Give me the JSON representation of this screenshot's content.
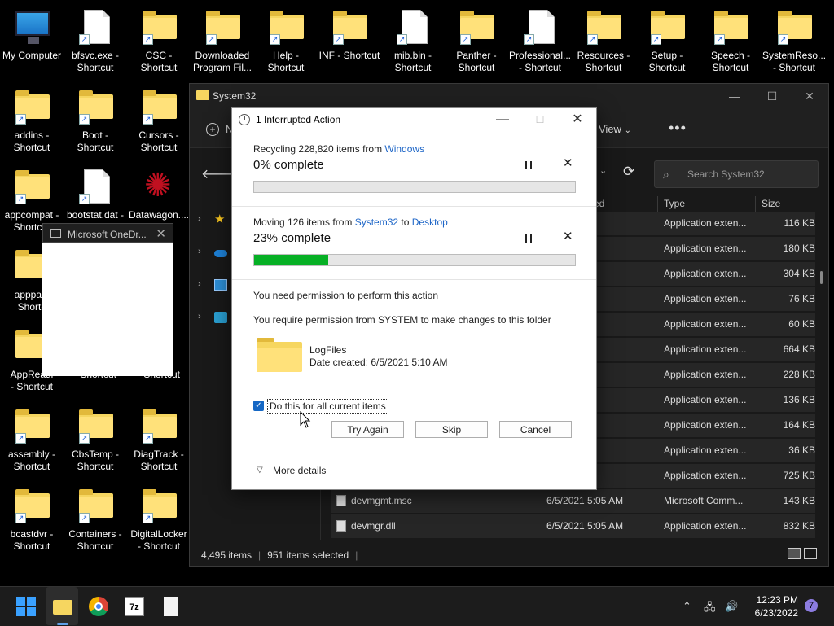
{
  "desktop": {
    "icons": [
      {
        "label1": "My Computer",
        "label2": ""
      },
      {
        "label1": "bfsvc.exe -",
        "label2": "Shortcut"
      },
      {
        "label1": "CSC -",
        "label2": "Shortcut"
      },
      {
        "label1": "Downloaded",
        "label2": "Program Fil..."
      },
      {
        "label1": "Help -",
        "label2": "Shortcut"
      },
      {
        "label1": "INF - Shortcut",
        "label2": ""
      },
      {
        "label1": "mib.bin -",
        "label2": "Shortcut"
      },
      {
        "label1": "Panther -",
        "label2": "Shortcut"
      },
      {
        "label1": "Professional...",
        "label2": "- Shortcut"
      },
      {
        "label1": "Resources -",
        "label2": "Shortcut"
      },
      {
        "label1": "Setup -",
        "label2": "Shortcut"
      },
      {
        "label1": "Speech -",
        "label2": "Shortcut"
      },
      {
        "label1": "SystemReso...",
        "label2": "- Shortcut"
      },
      {
        "label1": "addins -",
        "label2": "Shortcut"
      },
      {
        "label1": "Boot -",
        "label2": "Shortcut"
      },
      {
        "label1": "Cursors -",
        "label2": "Shortcut"
      },
      {
        "label1": "appcompat -",
        "label2": "Shortcut"
      },
      {
        "label1": "bootstat.dat -",
        "label2": ""
      },
      {
        "label1": "Datawagon....",
        "label2": ""
      },
      {
        "label1": "apppatc",
        "label2": "Shortc"
      },
      {
        "label1": "AppReadi",
        "label2": "- Shortcut"
      },
      {
        "label1": "",
        "label2": "- Shortcut"
      },
      {
        "label1": "",
        "label2": "- Shortcut"
      },
      {
        "label1": "assembly -",
        "label2": "Shortcut"
      },
      {
        "label1": "CbsTemp -",
        "label2": "Shortcut"
      },
      {
        "label1": "DiagTrack -",
        "label2": "Shortcut"
      },
      {
        "label1": "bcastdvr -",
        "label2": "Shortcut"
      },
      {
        "label1": "Containers -",
        "label2": "Shortcut"
      },
      {
        "label1": "DigitalLocker",
        "label2": "- Shortcut"
      }
    ]
  },
  "explorer": {
    "title": "System32",
    "new_label": "N",
    "view_label": "View",
    "view_chevron": "⌄",
    "more_label": "•••",
    "search_placeholder": "Search System32",
    "columns": {
      "date": "ed",
      "type": "Type",
      "size": "Size"
    },
    "rows": [
      {
        "name": "",
        "date": "",
        "type": "Application exten...",
        "size": "116 KB"
      },
      {
        "name": "",
        "date": ":22 PM",
        "type": "Application exten...",
        "size": "180 KB"
      },
      {
        "name": "",
        "date": ":05 AM",
        "type": "Application exten...",
        "size": "304 KB"
      },
      {
        "name": "",
        "date": ":23 PM",
        "type": "Application exten...",
        "size": "76 KB"
      },
      {
        "name": "",
        "date": ":23 PM",
        "type": "Application exten...",
        "size": "60 KB"
      },
      {
        "name": "",
        "date": ":23 PM",
        "type": "Application exten...",
        "size": "664 KB"
      },
      {
        "name": "",
        "date": ":23 PM",
        "type": "Application exten...",
        "size": "228 KB"
      },
      {
        "name": "",
        "date": ":23 PM",
        "type": "Application exten...",
        "size": "136 KB"
      },
      {
        "name": "",
        "date": ":24 PM",
        "type": "Application exten...",
        "size": "164 KB"
      },
      {
        "name": "",
        "date": ":06 AM",
        "type": "Application exten...",
        "size": "36 KB"
      },
      {
        "name": "",
        "date": ":05 AM",
        "type": "Application exten...",
        "size": "725 KB"
      },
      {
        "name": "devmgmt.msc",
        "date": "6/5/2021 5:05 AM",
        "type": "Microsoft Comm...",
        "size": "143 KB"
      },
      {
        "name": "devmgr.dll",
        "date": "6/5/2021 5:05 AM",
        "type": "Application exten...",
        "size": "832 KB"
      }
    ],
    "status": {
      "items": "4,495 items",
      "selected": "951 items selected"
    }
  },
  "onedrive": {
    "title": "Microsoft OneDr..."
  },
  "dialog": {
    "title": "1 Interrupted Action",
    "op1": {
      "verb": "Recycling 228,820 items from ",
      "source": "Windows",
      "percent_text": "0% complete",
      "progress": 0
    },
    "op2": {
      "verb": "Moving 126 items from ",
      "source": "System32",
      "to": " to ",
      "dest": "Desktop",
      "percent_text": "23% complete",
      "progress": 23
    },
    "permission_title": "You need permission to perform this action",
    "permission_detail": "You require permission from SYSTEM to make changes to this folder",
    "folder_name": "LogFiles",
    "folder_date": "Date created: 6/5/2021 5:10 AM",
    "checkbox_label": "Do this for all current items",
    "checkbox_checked": true,
    "buttons": {
      "try_again": "Try Again",
      "skip": "Skip",
      "cancel": "Cancel"
    },
    "more_details": "More details"
  },
  "taskbar": {
    "time": "12:23 PM",
    "date": "6/23/2022",
    "notification_count": "7",
    "sevenzip_label": "7z"
  },
  "colors": {
    "progress_green": "#06b025",
    "link_blue": "#1e66c7",
    "accent": "#3aa1ff"
  }
}
